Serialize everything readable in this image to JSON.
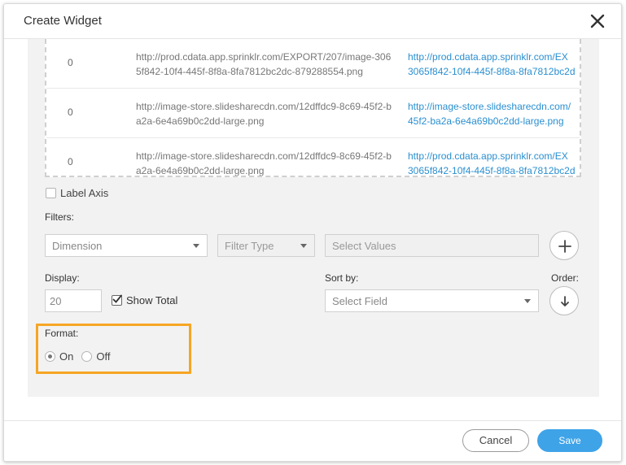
{
  "dialog": {
    "title": "Create Widget"
  },
  "table": {
    "rows": [
      {
        "value": "0",
        "source": "http://prod.cdata.app.sprinklr.com/EXPORT/207/image-3065f842-10f4-445f-8f8a-8fa7812bc2dc-879288554.png",
        "link_line1": "http://prod.cdata.app.sprinklr.com/EX",
        "link_line2": "3065f842-10f4-445f-8f8a-8fa7812bc2d"
      },
      {
        "value": "0",
        "source": "http://image-store.slidesharecdn.com/12dffdc9-8c69-45f2-ba2a-6e4a69b0c2dd-large.png",
        "link_line1": "http://image-store.slidesharecdn.com/",
        "link_line2": "45f2-ba2a-6e4a69b0c2dd-large.png"
      },
      {
        "value": "0",
        "source": "http://image-store.slidesharecdn.com/12dffdc9-8c69-45f2-ba2a-6e4a69b0c2dd-large.png",
        "link_line1": "http://prod.cdata.app.sprinklr.com/EX",
        "link_line2": "3065f842-10f4-445f-8f8a-8fa7812bc2d"
      }
    ]
  },
  "label_axis": {
    "label": "Label Axis",
    "checked": false
  },
  "filters": {
    "label": "Filters:",
    "dimension_placeholder": "Dimension",
    "filter_type_placeholder": "Filter Type",
    "values_placeholder": "Select Values"
  },
  "display": {
    "label": "Display:",
    "value": "20",
    "show_total_label": "Show Total",
    "show_total_checked": true
  },
  "sort": {
    "label": "Sort by:",
    "placeholder": "Select Field",
    "order_label": "Order:"
  },
  "format": {
    "label": "Format:",
    "on_label": "On",
    "off_label": "Off",
    "selected": "On"
  },
  "footer": {
    "cancel_label": "Cancel",
    "save_label": "Save"
  },
  "colors": {
    "accent": "#3fa3e8",
    "highlight": "#f6a623",
    "link": "#2a8fd0"
  }
}
